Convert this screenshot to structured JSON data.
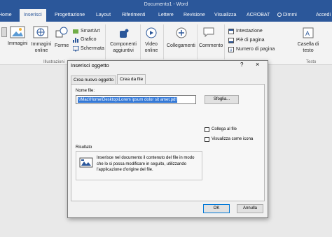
{
  "window": {
    "title": "Documento1 - Word"
  },
  "tabs": [
    "Home",
    "Inserisci",
    "Progettazione",
    "Layout",
    "Riferimenti",
    "Lettere",
    "Revisione",
    "Visualizza",
    "ACROBAT"
  ],
  "tell_me": "Dimmi",
  "share": "Accedi",
  "ribbon": {
    "immagini": "Immagini",
    "immagini_online_1": "Immagini",
    "immagini_online_2": "online",
    "forme": "Forme",
    "smartart": "SmartArt",
    "grafico": "Grafico",
    "schermata": "Schermata",
    "illustrazioni": "Illustrazioni",
    "componenti_1": "Componenti",
    "componenti_2": "aggiuntivi",
    "video_1": "Video",
    "video_2": "online",
    "collegamenti": "Collegamenti",
    "commento": "Commento",
    "intestazione": "Intestazione",
    "pie_pagina": "Piè di pagina",
    "numero_pagina": "Numero di pagina",
    "casella_1": "Casella di",
    "casella_2": "testo",
    "testo_group": "Testo"
  },
  "dialog": {
    "title": "Inserisci oggetto",
    "help": "?",
    "close": "×",
    "tab_new": "Crea nuovo oggetto",
    "tab_file": "Crea da file",
    "file_label": "Nome file:",
    "file_value": "\\\\Mac\\Home\\Desktop\\Lorem ipsum dolor sit amet.pdf",
    "browse": "Sfoglia...",
    "link_label": "Collega al file",
    "icon_label": "Visualizza come icona",
    "result_label": "Risultato",
    "result_text": "Inserisce nel documento il contenuto del file in modo che lo si possa modificare in seguito, utilizzando l'applicazione d'origine del file.",
    "ok": "OK",
    "cancel": "Annulla"
  },
  "colors": {
    "accent": "#2b579a",
    "ribbon": "#f3f3f3",
    "selection": "#3378d6"
  }
}
